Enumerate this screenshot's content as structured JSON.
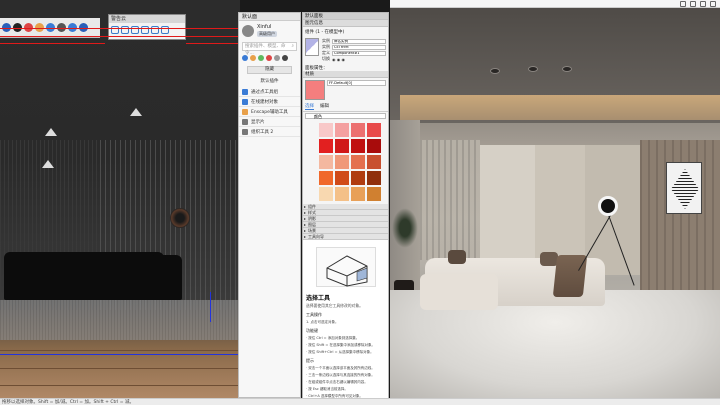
{
  "colors": {
    "viewport_redline": "#e01a1a",
    "viewport_blueline": "#2233dd",
    "accent": "#3a7bd5"
  },
  "viewport": {
    "window_title": "警告云",
    "toolbar_icon_names": [
      "info-icon",
      "plus-icon",
      "layers-icon",
      "cloud-icon",
      "settings-icon"
    ]
  },
  "status": {
    "text": "拖移以选择对象。Shift = 加/减。Ctrl = 加。Shift + Ctrl = 减。"
  },
  "tray": {
    "title": "默认面",
    "user_name": "Xinful",
    "user_badge": "高级用户",
    "search_placeholder": "搜索插件、模型、命令...",
    "button": "隐藏",
    "section_label": "默认插件",
    "items": [
      {
        "label": "通过点工具组",
        "icon_color": "#3a7bd5"
      },
      {
        "label": "在线建材对象",
        "icon_color": "#3a7bd5"
      },
      {
        "label": "Enscape辅助工具",
        "icon_color": "#e8a04a"
      },
      {
        "label": "显示片",
        "icon_color": "#777777"
      },
      {
        "label": "组织工具 2",
        "icon_color": "#777777"
      }
    ]
  },
  "dtray": {
    "title": "默认面板",
    "entity_header": "图元信息",
    "entity_row": "组件 (1 - 在模型中)",
    "entity_fields": [
      {
        "label": "实例",
        "value": "命名实例"
      },
      {
        "label": "实例",
        "value": "CETR9M"
      },
      {
        "label": "定义",
        "value": "Component#1"
      },
      {
        "label": "切换",
        "value": ""
      }
    ],
    "material_header": "材质",
    "material_title": "面板属性：",
    "material_name": "FF-Default[0]",
    "mat_tabs": [
      "选择",
      "编辑"
    ],
    "mat_select_value": "颜色",
    "swatch_color": "#f47e7e",
    "collapsed_sections": [
      "组件",
      "样式",
      "阴影",
      "图层",
      "场景",
      "工具向导"
    ],
    "instructor_title": "选择工具",
    "instructor_sub": "选择要使用其它工具修改的对象。",
    "instructor_section_1": "工具操作",
    "instructor_line_1": "1. 点击可选定对象。",
    "instructor_section_2": "功能键",
    "instructor_lines": [
      "· 按住 Ctrl = 添加对象到选择集。",
      "· 按住 Shift = 在选择集中添加或移除对象。",
      "· 按住 Shift+Ctrl = 从选择集中移除对象。"
    ],
    "instructor_section_3": "提示",
    "instructor_tips": [
      "· 双击一个平面以选择该平面及其所有边线。",
      "· 三击一条边线以选择与其连接的所有对象。",
      "· 在组或组件中点击右键以编辑其内容。",
      "· 按 Esc 键取消当前选择。",
      "· Ctrl+A 选择模型中所有可见对象。"
    ],
    "bottom_link": "高级"
  },
  "material_grid": [
    "#f8c8c8",
    "#f4a0a0",
    "#ec7070",
    "#e84a4a",
    "#e22020",
    "#d01818",
    "#c01010",
    "#a80c0c",
    "#f4b8a0",
    "#f09878",
    "#e47050",
    "#c85030",
    "#f0682a",
    "#d04a18",
    "#b03c10",
    "#90300c",
    "#f8d8b0",
    "#f4c088",
    "#e8a058",
    "#d08030"
  ],
  "render": {
    "top_icons": [
      "screen-icon",
      "camera-icon",
      "grid-icon",
      "settings-icon"
    ]
  }
}
